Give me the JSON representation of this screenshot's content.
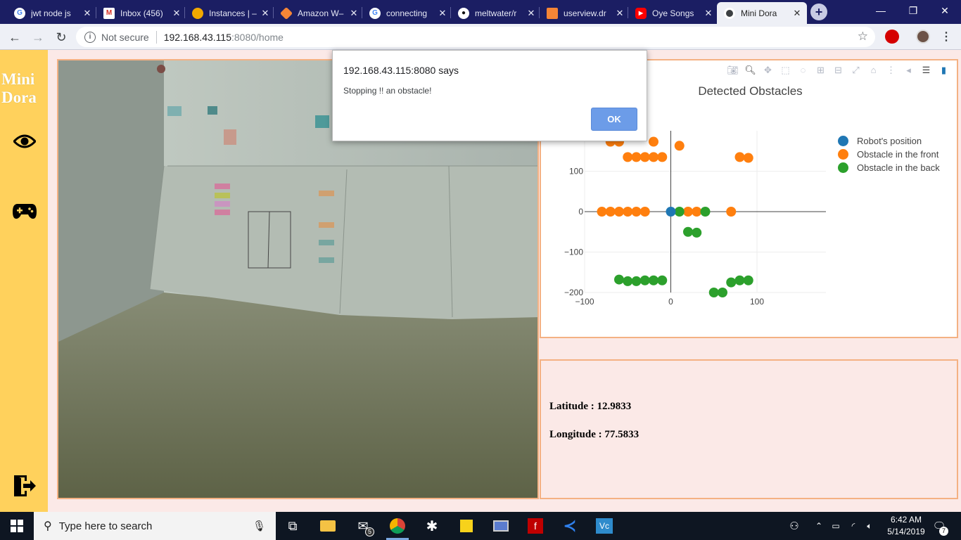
{
  "browser": {
    "tabs": [
      {
        "title": "jwt node js",
        "icon": "google-icon",
        "color": "#4285f4"
      },
      {
        "title": "Inbox (456)",
        "icon": "gmail-icon",
        "color": "#d93025"
      },
      {
        "title": "Instances | –",
        "icon": "instances-icon",
        "color": "#f2a900"
      },
      {
        "title": "Amazon W–",
        "icon": "amazon-icon",
        "color": "#f58536"
      },
      {
        "title": "connecting",
        "icon": "google-icon",
        "color": "#4285f4"
      },
      {
        "title": "meltwater/r",
        "icon": "github-icon",
        "color": "#ffffff"
      },
      {
        "title": "userview.dr",
        "icon": "userview-icon",
        "color": "#f58536"
      },
      {
        "title": "Oye Songs",
        "icon": "youtube-icon",
        "color": "#ff0000"
      },
      {
        "title": "Mini Dora",
        "icon": "chrome-icon",
        "color": "#ffffff"
      }
    ],
    "omnibox": {
      "security": "Not secure",
      "host": "192.168.43.115",
      "path": ":8080/home"
    }
  },
  "sidebar": {
    "brand_line1": "Mini",
    "brand_line2": "Dora"
  },
  "alert": {
    "origin": "192.168.43.115:8080 says",
    "message": "Stopping !! an obstacle!",
    "ok_label": "OK"
  },
  "location": {
    "latitude_label": "Latitude : ",
    "latitude": "12.9833",
    "longitude_label": "Longitude : ",
    "longitude": "77.5833"
  },
  "chart_data": {
    "type": "scatter",
    "title": "Detected Obstacles",
    "xlim": [
      -100,
      180
    ],
    "ylim": [
      -200,
      200
    ],
    "xticks": [
      -100,
      0,
      100
    ],
    "yticks": [
      100,
      0,
      -100,
      -200
    ],
    "xtick_labels": [
      "−100",
      "0",
      "100"
    ],
    "ytick_labels": [
      "100",
      "0",
      "−100",
      "−200"
    ],
    "legend_position": "top-right",
    "series": [
      {
        "name": "Robot's position",
        "color": "#1f77b4",
        "points": [
          [
            0,
            0
          ]
        ]
      },
      {
        "name": "Obstacle in the front",
        "color": "#ff7f0e",
        "points": [
          [
            -70,
            173
          ],
          [
            -60,
            173
          ],
          [
            -20,
            173
          ],
          [
            10,
            163
          ],
          [
            -50,
            135
          ],
          [
            -40,
            135
          ],
          [
            -30,
            135
          ],
          [
            -20,
            135
          ],
          [
            -10,
            135
          ],
          [
            80,
            135
          ],
          [
            90,
            133
          ],
          [
            -80,
            0
          ],
          [
            -70,
            0
          ],
          [
            -60,
            0
          ],
          [
            -50,
            0
          ],
          [
            -40,
            0
          ],
          [
            -30,
            0
          ],
          [
            20,
            0
          ],
          [
            30,
            0
          ],
          [
            70,
            0
          ]
        ]
      },
      {
        "name": "Obstacle in the back",
        "color": "#2ca02c",
        "points": [
          [
            10,
            0
          ],
          [
            40,
            0
          ],
          [
            20,
            -50
          ],
          [
            30,
            -52
          ],
          [
            -60,
            -168
          ],
          [
            -50,
            -172
          ],
          [
            -40,
            -172
          ],
          [
            -30,
            -170
          ],
          [
            -20,
            -170
          ],
          [
            -10,
            -170
          ],
          [
            50,
            -200
          ],
          [
            60,
            -200
          ],
          [
            70,
            -175
          ],
          [
            80,
            -170
          ],
          [
            90,
            -170
          ]
        ]
      }
    ]
  },
  "taskbar": {
    "search_placeholder": "Type here to search",
    "time": "6:42 AM",
    "date": "5/14/2019",
    "mail_badge": "5",
    "notification_count": "7"
  }
}
